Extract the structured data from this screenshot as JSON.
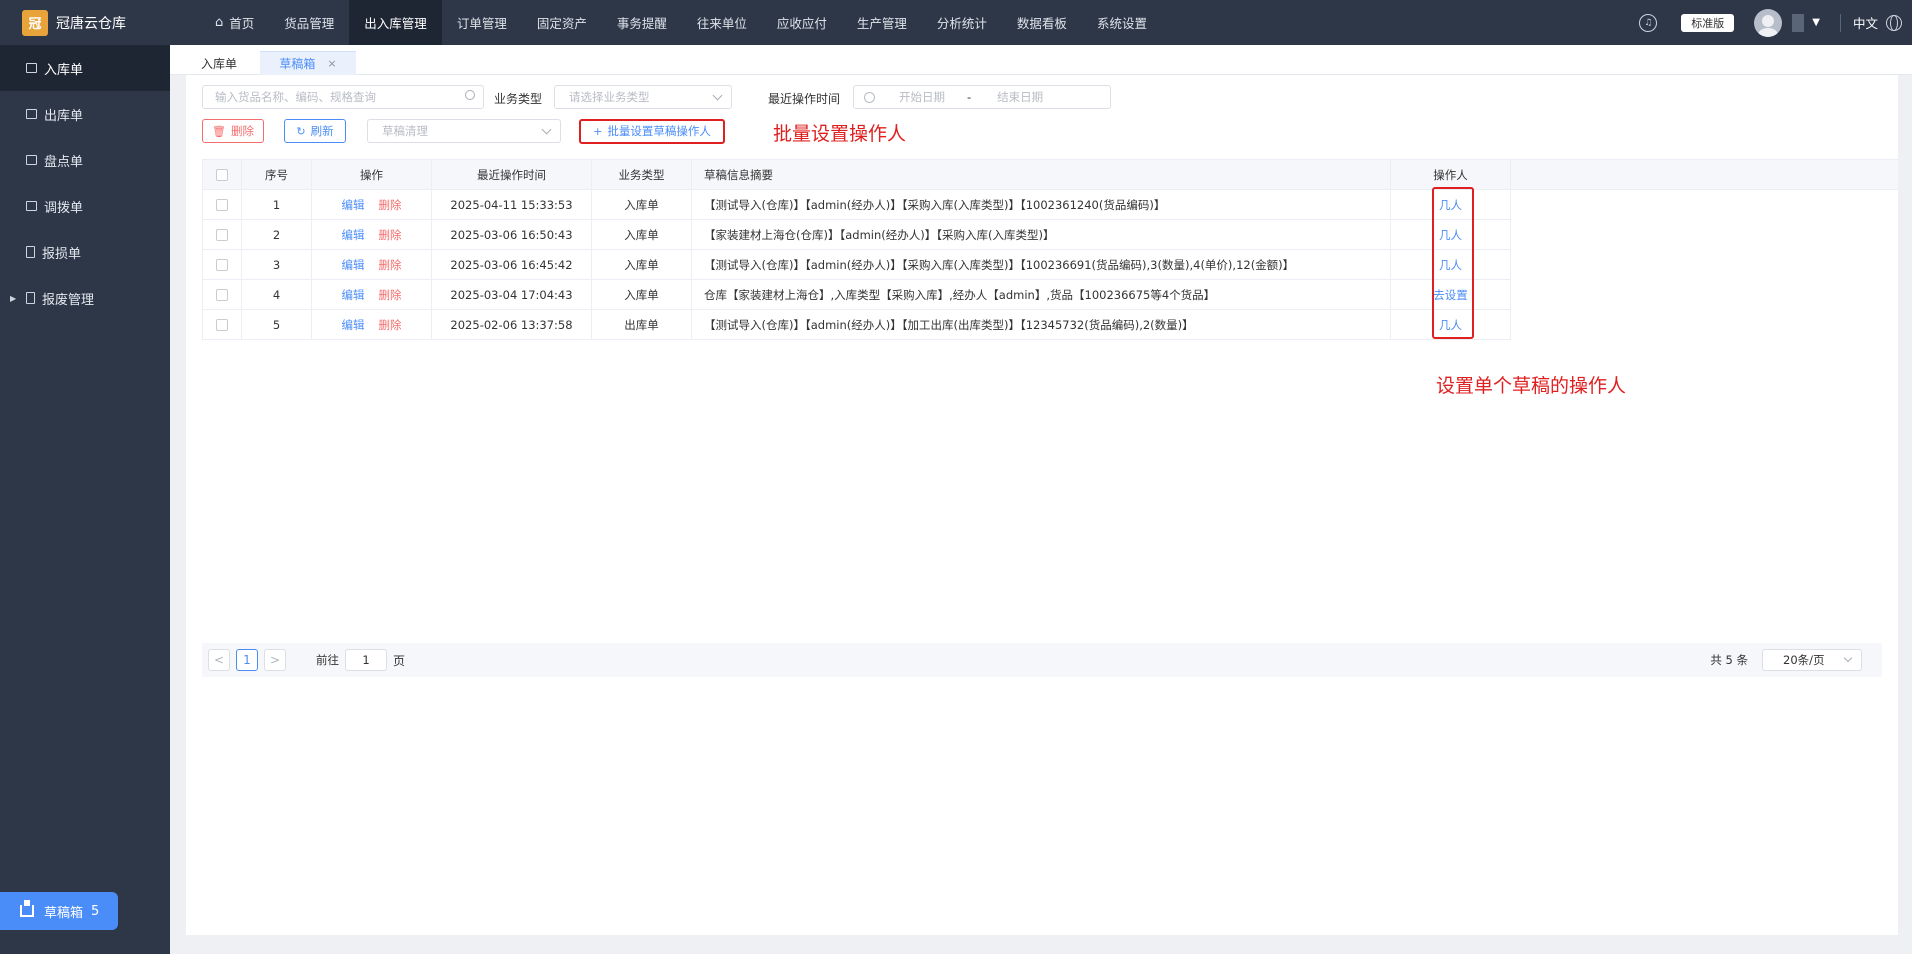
{
  "app": {
    "name": "冠唐云仓库",
    "logo_glyph": "冠"
  },
  "nav": {
    "items": [
      {
        "label": "首页",
        "icon": "home-icon"
      },
      {
        "label": "货品管理"
      },
      {
        "label": "出入库管理",
        "active": true
      },
      {
        "label": "订单管理"
      },
      {
        "label": "固定资产"
      },
      {
        "label": "事务提醒"
      },
      {
        "label": "往来单位"
      },
      {
        "label": "应收应付"
      },
      {
        "label": "生产管理"
      },
      {
        "label": "分析统计"
      },
      {
        "label": "数据看板"
      },
      {
        "label": "系统设置"
      }
    ],
    "edition": "标准版",
    "lang": "中文"
  },
  "sidebar": {
    "items": [
      {
        "label": "入库单",
        "active": true
      },
      {
        "label": "出库单"
      },
      {
        "label": "盘点单"
      },
      {
        "label": "调拨单"
      },
      {
        "label": "报损单"
      },
      {
        "label": "报废管理",
        "expandable": true
      }
    ],
    "draft_box": {
      "label": "草稿箱",
      "count": "5"
    }
  },
  "tabs": [
    {
      "label": "入库单"
    },
    {
      "label": "草稿箱",
      "active": true,
      "close": "×"
    }
  ],
  "filters": {
    "search_placeholder": "输入货品名称、编码、规格查询",
    "biz_type_label": "业务类型",
    "biz_type_placeholder": "请选择业务类型",
    "time_label": "最近操作时间",
    "start_placeholder": "开始日期",
    "range_sep": "-",
    "end_placeholder": "结束日期"
  },
  "toolbar": {
    "delete": "删除",
    "refresh": "刷新",
    "clear_placeholder": "草稿清理",
    "batch": "批量设置草稿操作人"
  },
  "annotations": {
    "batch_note": "批量设置操作人",
    "single_note": "设置单个草稿的操作人"
  },
  "table": {
    "headers": {
      "no": "序号",
      "op": "操作",
      "time": "最近操作时间",
      "type": "业务类型",
      "summary": "草稿信息摘要",
      "operator": "操作人"
    },
    "rows": [
      {
        "no": "1",
        "edit": "编辑",
        "del": "删除",
        "time": "2025-04-11 15:33:53",
        "type": "入库单",
        "summary": "【测试导入(仓库)】【admin(经办人)】【采购入库(入库类型)】【1002361240(货品编码)】",
        "operator": "几人"
      },
      {
        "no": "2",
        "edit": "编辑",
        "del": "删除",
        "time": "2025-03-06 16:50:43",
        "type": "入库单",
        "summary": "【家装建材上海仓(仓库)】【admin(经办人)】【采购入库(入库类型)】",
        "operator": "几人"
      },
      {
        "no": "3",
        "edit": "编辑",
        "del": "删除",
        "time": "2025-03-06 16:45:42",
        "type": "入库单",
        "summary": "【测试导入(仓库)】【admin(经办人)】【采购入库(入库类型)】【100236691(货品编码),3(数量),4(单价),12(金额)】",
        "operator": "几人"
      },
      {
        "no": "4",
        "edit": "编辑",
        "del": "删除",
        "time": "2025-03-04 17:04:43",
        "type": "入库单",
        "summary": "仓库【家装建材上海仓】,入库类型【采购入库】,经办人【admin】,货品【100236675等4个货品】",
        "operator": "去设置"
      },
      {
        "no": "5",
        "edit": "编辑",
        "del": "删除",
        "time": "2025-02-06 13:37:58",
        "type": "出库单",
        "summary": "【测试导入(仓库)】【admin(经办人)】【加工出库(出库类型)】【12345732(货品编码),2(数量)】",
        "operator": "几人"
      }
    ]
  },
  "pager": {
    "prev": "<",
    "current": "1",
    "next": ">",
    "goto_prefix": "前往",
    "goto_value": "1",
    "goto_suffix": "页",
    "total": "共 5 条",
    "page_size": "20条/页"
  },
  "colors": {
    "accent": "#4b8df8",
    "danger": "#f56c6c",
    "annotation": "#e02020",
    "nav_bg": "#2d3748"
  }
}
